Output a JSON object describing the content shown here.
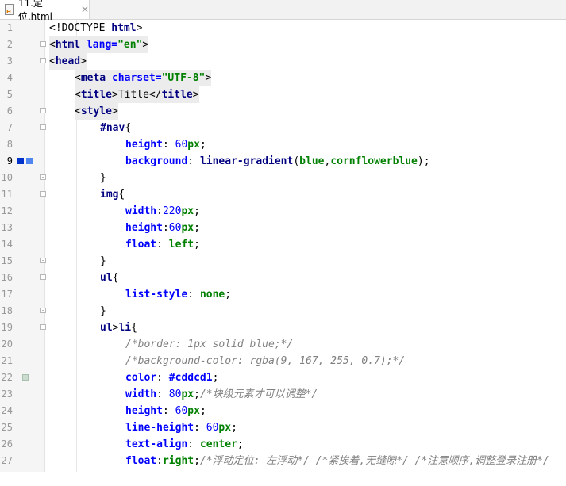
{
  "tab": {
    "filename": "11.定位.html",
    "close_glyph": "✕"
  },
  "colors": {
    "blue_marker": "#0033cc",
    "cornflower_marker": "#4f86f0",
    "swatch_cddcd1": "#cddcd1"
  },
  "lines": [
    {
      "n": "1"
    },
    {
      "n": "2"
    },
    {
      "n": "3"
    },
    {
      "n": "4"
    },
    {
      "n": "5"
    },
    {
      "n": "6"
    },
    {
      "n": "7"
    },
    {
      "n": "8"
    },
    {
      "n": "9"
    },
    {
      "n": "10"
    },
    {
      "n": "11"
    },
    {
      "n": "12"
    },
    {
      "n": "13"
    },
    {
      "n": "14"
    },
    {
      "n": "15"
    },
    {
      "n": "16"
    },
    {
      "n": "17"
    },
    {
      "n": "18"
    },
    {
      "n": "19"
    },
    {
      "n": "20"
    },
    {
      "n": "21"
    },
    {
      "n": "22"
    },
    {
      "n": "23"
    },
    {
      "n": "24"
    },
    {
      "n": "25"
    },
    {
      "n": "26"
    },
    {
      "n": "27"
    }
  ],
  "code": {
    "l1": [
      "<!DOCTYPE ",
      "html",
      ">"
    ],
    "l2": [
      "<",
      "html ",
      "lang=",
      "\"en\"",
      ">"
    ],
    "l3": [
      "<",
      "head",
      ">"
    ],
    "l4": [
      "<",
      "meta ",
      "charset=",
      "\"UTF-8\"",
      ">"
    ],
    "l5": [
      "<",
      "title",
      ">Title</",
      "title",
      ">"
    ],
    "l6": [
      "<",
      "style",
      ">"
    ],
    "l7": [
      "#nav",
      "{"
    ],
    "l8": [
      "height",
      ": ",
      "60",
      "px",
      ";"
    ],
    "l9": [
      "background",
      ": ",
      "linear-gradient",
      "(",
      "blue",
      ",",
      "cornflowerblue",
      ");"
    ],
    "l10": [
      "}"
    ],
    "l11": [
      "img",
      "{"
    ],
    "l12": [
      "width",
      ":",
      "220",
      "px",
      ";"
    ],
    "l13": [
      "height",
      ":",
      "60",
      "px",
      ";"
    ],
    "l14": [
      "float",
      ": ",
      "left",
      ";"
    ],
    "l15": [
      "}"
    ],
    "l16": [
      "ul",
      "{"
    ],
    "l17": [
      "list-style",
      ": ",
      "none",
      ";"
    ],
    "l18": [
      "}"
    ],
    "l19": [
      "ul",
      ">",
      "li",
      "{"
    ],
    "l20": [
      "/*border: 1px solid blue;*/"
    ],
    "l21": [
      "/*background-color: rgba(9, 167, 255, 0.7);*/"
    ],
    "l22": [
      "color",
      ": ",
      "#cddcd1",
      ";"
    ],
    "l23": [
      "width",
      ": ",
      "80",
      "px",
      ";",
      "/*块级元素才可以调整*/"
    ],
    "l24": [
      "height",
      ": ",
      "60",
      "px",
      ";"
    ],
    "l25": [
      "line-height",
      ": ",
      "60",
      "px",
      ";"
    ],
    "l26": [
      "text-align",
      ": ",
      "center",
      ";"
    ],
    "l27": [
      "float",
      ":",
      "right",
      ";",
      "/*浮动定位: 左浮动*/ /*紧挨着,无缝隙*/ /*注意顺序,调整登录注册*/"
    ]
  }
}
